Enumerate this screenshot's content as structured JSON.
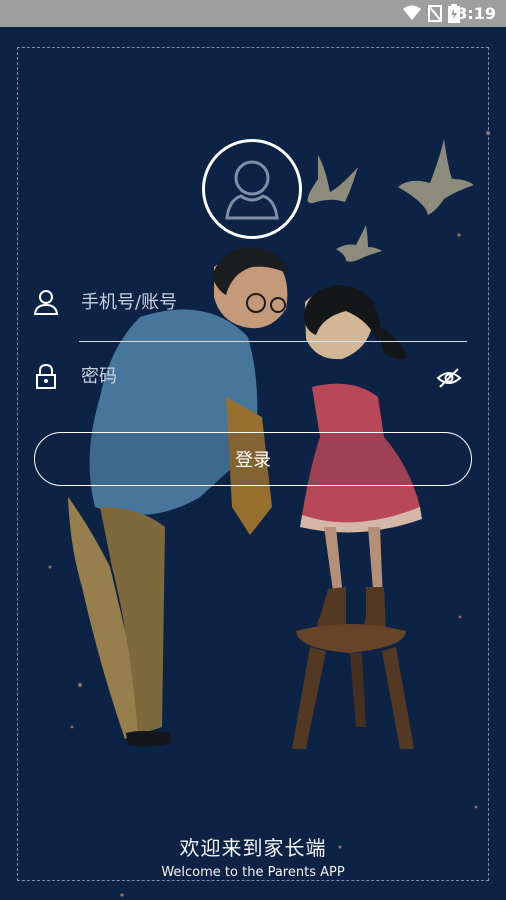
{
  "status": {
    "time": "3:19"
  },
  "login": {
    "account_placeholder": "手机号/账号",
    "password_placeholder": "密码",
    "button_label": "登录"
  },
  "welcome": {
    "title_cn": "欢迎来到家长端",
    "subtitle_en": "Welcome to the Parents APP"
  },
  "icons": {
    "avatar": "user-avatar-icon",
    "account": "user-icon",
    "password": "lock-icon",
    "toggle": "eye-off-icon"
  },
  "colors": {
    "background": "#0d2346",
    "accent": "#ffffff"
  }
}
